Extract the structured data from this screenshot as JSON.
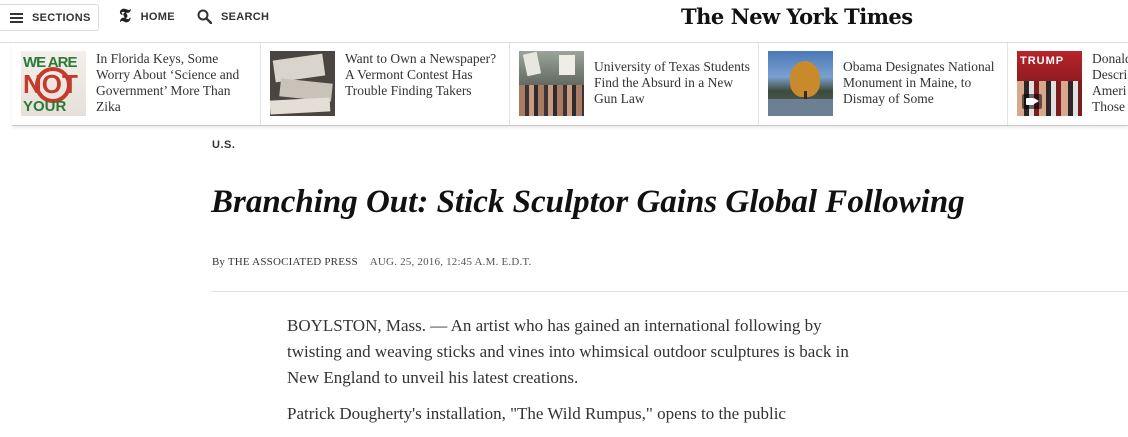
{
  "nav": {
    "sections_label": "SECTIONS",
    "home_glyph": "𝕿",
    "home_label": "HOME",
    "search_label": "SEARCH",
    "masthead": "The New York Times"
  },
  "ribbon": {
    "stories": [
      {
        "headline": "In Florida Keys, Some Worry About ‘Science and Government’ More Than Zika",
        "thumb": "zika-protest-sign"
      },
      {
        "headline": "Want to Own a Newspaper? A Vermont Contest Has Trouble Finding Takers",
        "thumb": "newspaper-stack"
      },
      {
        "headline": "University of Texas Students Find the Absurd in a New Gun Law",
        "thumb": "campus-protest"
      },
      {
        "headline": "Obama Designates National Monument in Maine, to Dismay of Some",
        "thumb": "maine-landscape"
      },
      {
        "headline": "Donald Trump Descri... America... Those...",
        "thumb": "rally-video"
      }
    ],
    "last_lines": [
      "Donald",
      "Descri",
      "Ameri",
      "Those"
    ],
    "thumb_texts": {
      "zika_line1": "WE ARE",
      "zika_line2": "NOT",
      "zika_line3": "YOUR",
      "trump_words": "TRUMP"
    }
  },
  "article": {
    "section": "U.S.",
    "title": "Branching Out: Stick Sculptor Gains Global Following",
    "byline_prefix": "By",
    "author": "THE ASSOCIATED PRESS",
    "date": "AUG. 25, 2016, 12:45 A.M. E.D.T.",
    "paragraphs": [
      "BOYLSTON, Mass. — An artist who has gained an international following by twisting and weaving sticks and vines into whimsical outdoor sculptures is back in New England to unveil his latest creations.",
      "Patrick Dougherty's installation, \"The Wild Rumpus,\" opens to the public"
    ]
  },
  "colors": {
    "accent": "#c43a2d",
    "text": "#333333",
    "rule": "#e2e2e2"
  }
}
